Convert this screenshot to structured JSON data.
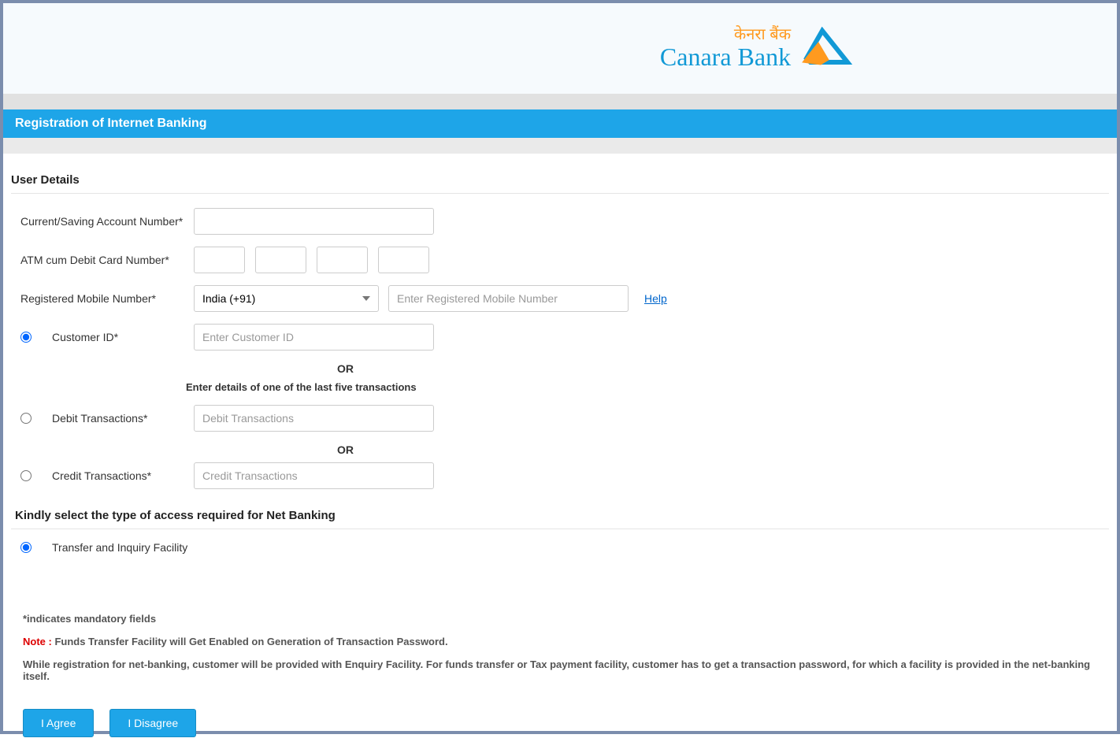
{
  "logo": {
    "hindi": "केनरा बैंक",
    "english": "Canara Bank"
  },
  "page_title": "Registration of Internet Banking",
  "section_user_details": "User Details",
  "labels": {
    "account_number": "Current/Saving Account Number*",
    "atm_card": "ATM cum Debit Card Number*",
    "mobile": "Registered Mobile Number*",
    "customer_id": "Customer ID*",
    "debit_trans": "Debit Transactions*",
    "credit_trans": "Credit Transactions*"
  },
  "country_code": "India (+91)",
  "placeholders": {
    "mobile": "Enter Registered Mobile Number",
    "customer_id": "Enter Customer ID",
    "debit": "Debit Transactions",
    "credit": "Credit Transactions"
  },
  "help_text": "Help",
  "or_text": "OR",
  "instruction_text": "Enter details of one of the last five transactions",
  "access_heading": "Kindly select the type of access required for Net Banking",
  "access_option": "Transfer and Inquiry Facility",
  "mandatory_note": "*indicates mandatory fields",
  "note_label": "Note : ",
  "note_text": "Funds Transfer Facility will Get Enabled on Generation of Transaction Password.",
  "disclaimer": "While registration for net-banking, customer will be provided with Enquiry Facility. For funds transfer or Tax payment facility, customer has to get a transaction password, for which a facility is provided in the net-banking itself.",
  "buttons": {
    "agree": "I Agree",
    "disagree": "I Disagree"
  }
}
